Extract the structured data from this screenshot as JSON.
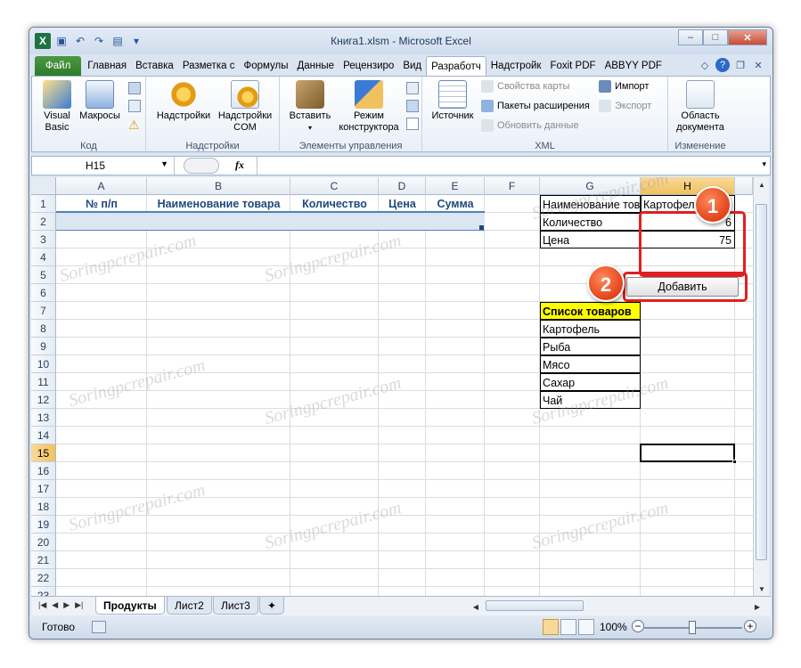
{
  "window": {
    "title": "Книга1.xlsm - Microsoft Excel"
  },
  "ribbon_tabs": [
    "Файл",
    "Главная",
    "Вставка",
    "Разметка с",
    "Формулы",
    "Данные",
    "Рецензиро",
    "Вид",
    "Разработч",
    "Надстройк",
    "Foxit PDF",
    "ABBYY PDF"
  ],
  "ribbon": {
    "code": {
      "label": "Код",
      "visual_basic": "Visual\nBasic",
      "macros": "Макросы"
    },
    "addins": {
      "label": "Надстройки",
      "addins": "Надстройки",
      "com": "Надстройки\nCOM"
    },
    "controls": {
      "label": "Элементы управления",
      "insert": "Вставить",
      "design": "Режим\nконструктора"
    },
    "xml": {
      "label": "XML",
      "source": "Источник",
      "map_props": "Свойства карты",
      "ext_packs": "Пакеты расширения",
      "refresh": "Обновить данные",
      "import": "Импорт",
      "export": "Экспорт"
    },
    "modify": {
      "label": "Изменение",
      "doc_panel": "Область\nдокумента"
    }
  },
  "formula_bar": {
    "name_box": "H15",
    "fx": "fx",
    "formula": ""
  },
  "columns": [
    "A",
    "B",
    "C",
    "D",
    "E",
    "F",
    "G",
    "H"
  ],
  "rows": [
    "1",
    "2",
    "3",
    "4",
    "5",
    "6",
    "7",
    "8",
    "9",
    "10",
    "11",
    "12",
    "13",
    "14",
    "15",
    "16",
    "17",
    "18",
    "19",
    "20",
    "21",
    "22",
    "23"
  ],
  "table_headers": [
    "№ п/п",
    "Наименование товара",
    "Количество",
    "Цена",
    "Сумма"
  ],
  "input_form": {
    "labels": [
      "Наименование товара",
      "Количество",
      "Цена"
    ],
    "values": [
      "Картофель",
      "6",
      "75"
    ]
  },
  "add_button": "Добавить",
  "product_list": {
    "title": "Список товаров",
    "items": [
      "Картофель",
      "Рыба",
      "Мясо",
      "Сахар",
      "Чай"
    ]
  },
  "badges": [
    "1",
    "2"
  ],
  "sheets": [
    "Продукты",
    "Лист2",
    "Лист3"
  ],
  "status": {
    "ready": "Готово",
    "zoom": "100%"
  },
  "watermark": "Soringpcrepair.com"
}
